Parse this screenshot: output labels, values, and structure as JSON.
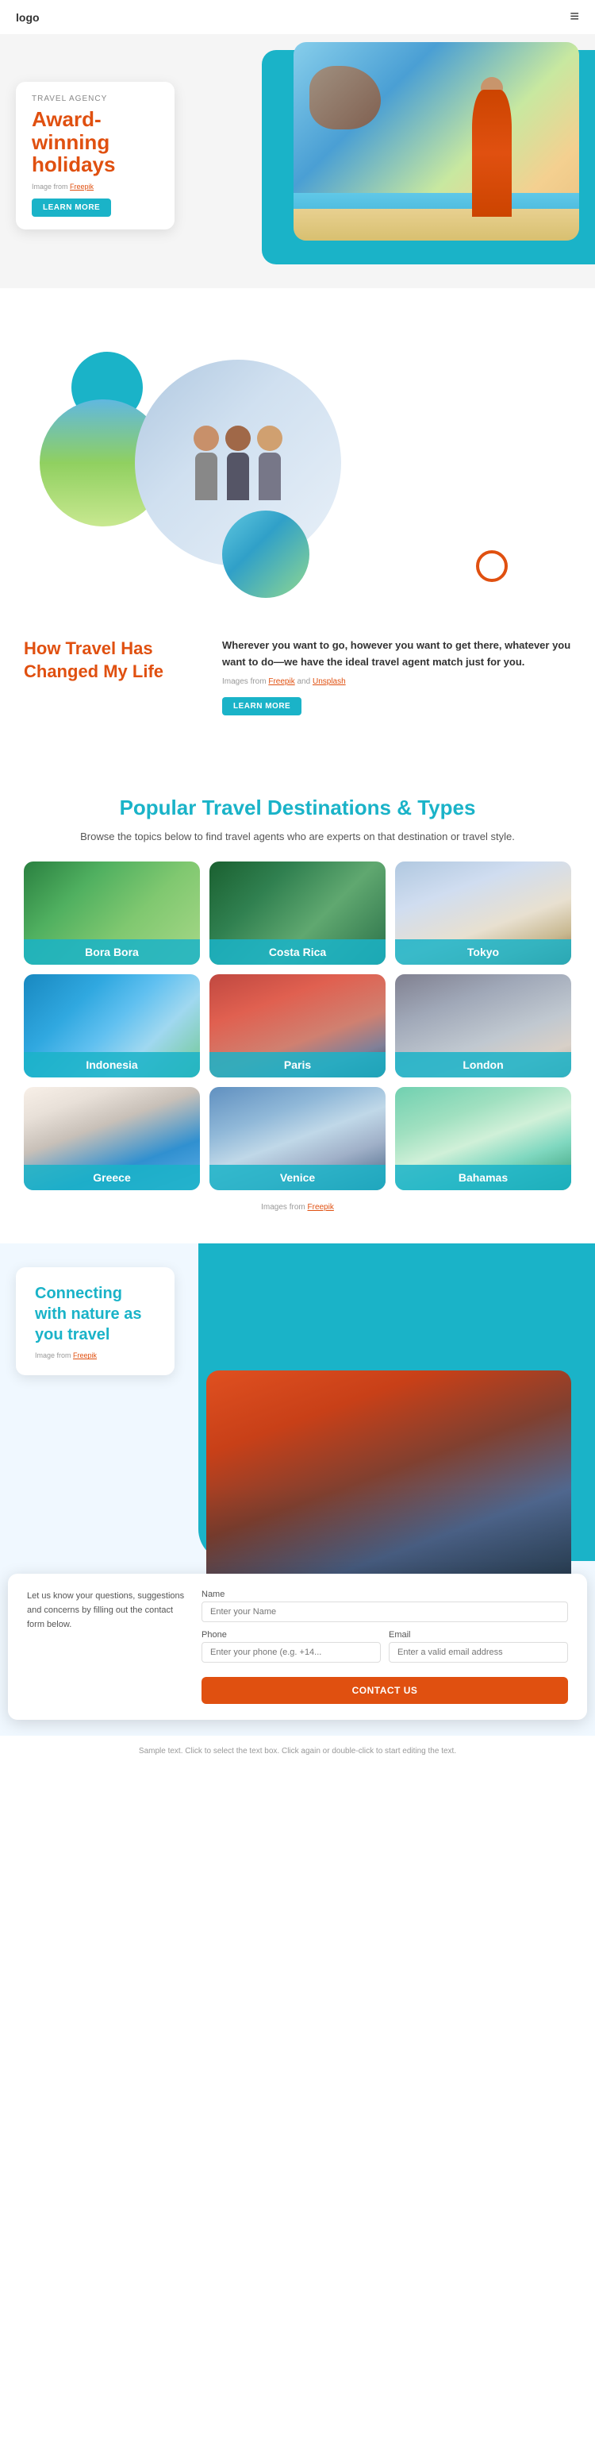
{
  "header": {
    "logo": "logo",
    "menu_icon": "≡"
  },
  "hero": {
    "agency_label": "TRAVEL AGENCY",
    "headline": "Award-winning holidays",
    "image_credit_text": "Image from",
    "image_credit_link": "Freepik",
    "learn_more": "LEARN MORE"
  },
  "travel_section": {
    "heading": "How Travel Has Changed My Life",
    "body": "Wherever you want to go, however you want to get there, whatever you want to do—we have the ideal travel agent match just for you.",
    "credit_text": "Images from",
    "credit_link1": "Freepik",
    "credit_and": "and",
    "credit_link2": "Unsplash",
    "learn_more": "LEARN MORE"
  },
  "destinations_section": {
    "heading": "Popular Travel Destinations & Types",
    "subtitle": "Browse the topics below to find travel agents who are experts on that destination or travel style.",
    "credit_text": "Images from",
    "credit_link": "Freepik",
    "destinations": [
      {
        "name": "Bora Bora",
        "bg_class": "bg-bora-bora"
      },
      {
        "name": "Costa Rica",
        "bg_class": "bg-costa-rica"
      },
      {
        "name": "Tokyo",
        "bg_class": "bg-tokyo"
      },
      {
        "name": "Indonesia",
        "bg_class": "bg-indonesia"
      },
      {
        "name": "Paris",
        "bg_class": "bg-paris"
      },
      {
        "name": "London",
        "bg_class": "bg-london"
      },
      {
        "name": "Greece",
        "bg_class": "bg-greece"
      },
      {
        "name": "Venice",
        "bg_class": "bg-venice"
      },
      {
        "name": "Bahamas",
        "bg_class": "bg-bahamas"
      }
    ]
  },
  "nature_section": {
    "heading": "Connecting with nature as you travel",
    "credit_text": "Image from",
    "credit_link": "Freepik"
  },
  "contact_section": {
    "intro": "Let us know your questions, suggestions and concerns by filling out the contact form below.",
    "name_label": "Name",
    "name_placeholder": "Enter your Name",
    "phone_label": "Phone",
    "phone_placeholder": "Enter your phone (e.g. +14...",
    "email_label": "Email",
    "email_placeholder": "Enter a valid email address",
    "submit_label": "CONTACT US"
  },
  "footer": {
    "note": "Sample text. Click to select the text box. Click again or double-click to start editing the text."
  }
}
